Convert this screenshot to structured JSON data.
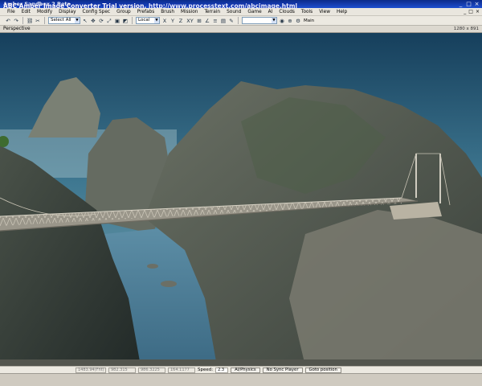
{
  "window": {
    "title": "Amber Sandbox 2 Beta",
    "controls": [
      "_",
      "□",
      "×"
    ]
  },
  "watermark": {
    "text": "ABC Amber Image Converter Trial version,",
    "link": "http://www.processtext.com/abcimage.html"
  },
  "menu": {
    "items": [
      "File",
      "Edit",
      "Modify",
      "Display",
      "Config Spec",
      "Group",
      "Prefabs",
      "Brush",
      "Mission",
      "Terrain",
      "Sound",
      "Game",
      "AI",
      "Clouds",
      "Tools",
      "View",
      "Help"
    ],
    "mdi_controls": [
      "_",
      "□",
      "×"
    ]
  },
  "toolbar": {
    "select_combo": "Select All",
    "coord_combo": "Local",
    "axis_x": "X",
    "axis_y": "Y",
    "axis_z": "Z",
    "axis_xy": "XY",
    "main_label": "Main"
  },
  "viewport": {
    "title": "Perspective",
    "resolution": "1280 x 891"
  },
  "status": {
    "pos_x": "1483.94(Fnt)",
    "pos_y": "982.315",
    "pos_z": "986.3225",
    "heading": "164.1177",
    "speed_label": "Speed:",
    "speed_value": "2.3",
    "ai_physics": "AI/Physics",
    "no_sync": "No Sync Player",
    "goto": "Goto position"
  },
  "colors": {
    "titlebar": "#1e4fd0",
    "sky_top": "#1a4a6a",
    "water": "#4a7a94",
    "rock": "#5b6159"
  }
}
